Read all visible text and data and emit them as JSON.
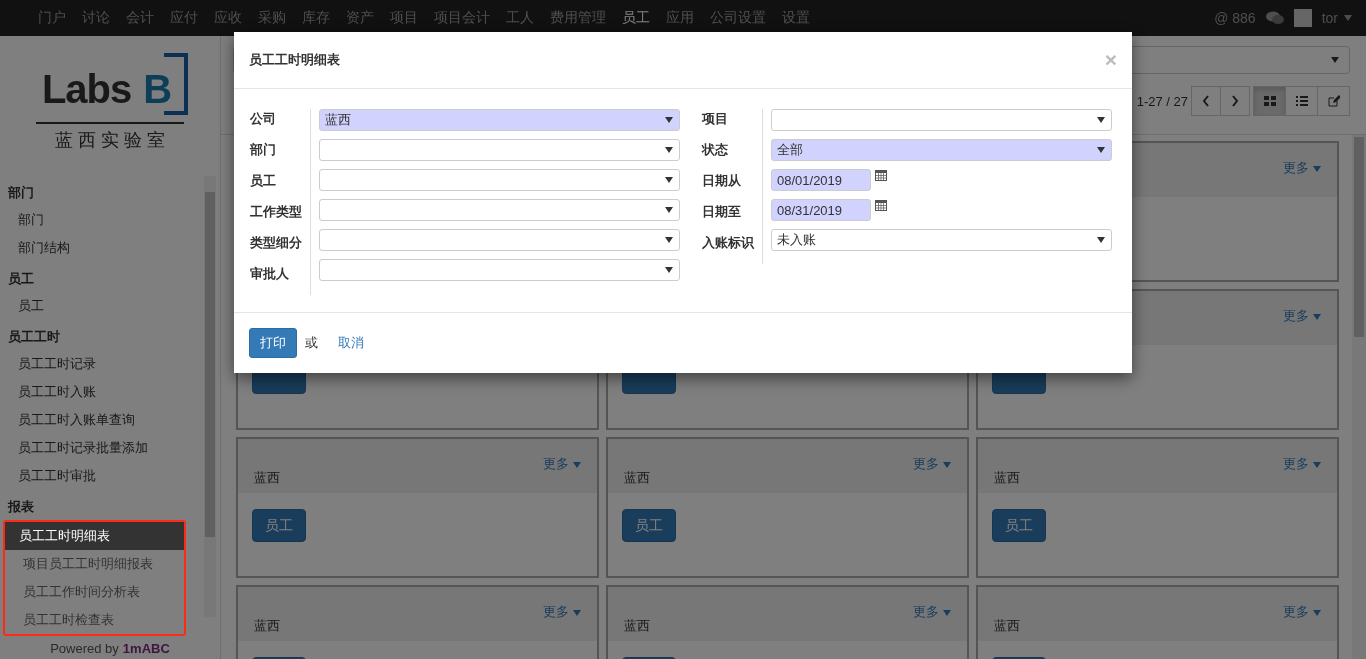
{
  "topbar": {
    "menu": [
      {
        "label": "门户",
        "selected": false
      },
      {
        "label": "讨论",
        "selected": false
      },
      {
        "label": "会计",
        "selected": false
      },
      {
        "label": "应付",
        "selected": false
      },
      {
        "label": "应收",
        "selected": false
      },
      {
        "label": "采购",
        "selected": false
      },
      {
        "label": "库存",
        "selected": false
      },
      {
        "label": "资产",
        "selected": false
      },
      {
        "label": "项目",
        "selected": false
      },
      {
        "label": "项目会计",
        "selected": false
      },
      {
        "label": "工人",
        "selected": false
      },
      {
        "label": "费用管理",
        "selected": false
      },
      {
        "label": "员工",
        "selected": true
      },
      {
        "label": "应用",
        "selected": false
      },
      {
        "label": "公司设置",
        "selected": false
      },
      {
        "label": "设置",
        "selected": false
      }
    ],
    "mentions": "@ 886",
    "user": "tor"
  },
  "logo": {
    "word": "Labs",
    "letter": "B",
    "subtitle": "蓝 西 实 验 室"
  },
  "sidebar": {
    "sections": [
      {
        "title": "部门",
        "items": [
          {
            "label": "部门",
            "selected": false
          },
          {
            "label": "部门结构",
            "selected": false
          }
        ]
      },
      {
        "title": "员工",
        "items": [
          {
            "label": "员工",
            "selected": false
          }
        ]
      },
      {
        "title": "员工工时",
        "items": [
          {
            "label": "员工工时记录",
            "selected": false
          },
          {
            "label": "员工工时入账",
            "selected": false
          },
          {
            "label": "员工工时入账单查询",
            "selected": false
          },
          {
            "label": "员工工时记录批量添加",
            "selected": false
          },
          {
            "label": "员工工时审批",
            "selected": false
          }
        ]
      },
      {
        "title": "报表",
        "highlighted": true,
        "items": [
          {
            "label": "员工工时明细表",
            "selected": true
          },
          {
            "label": "项目员工工时明细报表",
            "selected": false
          },
          {
            "label": "员工工作时间分析表",
            "selected": false
          },
          {
            "label": "员工工时检查表",
            "selected": false
          }
        ]
      }
    ],
    "footer": {
      "prefix": "Powered by",
      "brand": "1mABC"
    }
  },
  "control_panel": {
    "pager": "1-27 / 27",
    "views": [
      {
        "kind": "kanban",
        "selected": true
      },
      {
        "kind": "list",
        "selected": false
      },
      {
        "kind": "edit",
        "selected": false
      }
    ]
  },
  "cards": [
    {
      "kind": "card",
      "more": "更多"
    },
    {
      "kind": "card",
      "button": true
    },
    {
      "kind": "card",
      "button": true
    },
    {
      "kind": "card",
      "more": "更多",
      "button": true
    },
    {
      "kind": "card",
      "more": "更多",
      "company": "蓝西",
      "button": true,
      "button_label": "员工"
    },
    {
      "kind": "card",
      "more": "更多",
      "company": "蓝西",
      "button": true,
      "button_label": "员工"
    },
    {
      "kind": "card",
      "more": "更多",
      "company": "蓝西",
      "button": true,
      "button_label": "员工"
    },
    {
      "kind": "card",
      "more": "更多",
      "company": "蓝西",
      "button": true
    },
    {
      "kind": "card",
      "more": "更多",
      "company": "蓝西",
      "button": true
    },
    {
      "kind": "card",
      "more": "更多",
      "company": "蓝西",
      "button": true
    }
  ],
  "dialog": {
    "title": "员工工时明细表",
    "close": "×",
    "left_fields": [
      {
        "label": "公司",
        "value": "蓝西",
        "kind": "select",
        "required": true
      },
      {
        "label": "部门",
        "kind": "select",
        "required": false
      },
      {
        "label": "员工",
        "kind": "select",
        "required": false
      },
      {
        "label": "工作类型",
        "kind": "select",
        "required": false
      },
      {
        "label": "类型细分",
        "kind": "select",
        "required": false
      },
      {
        "label": "审批人",
        "kind": "select",
        "required": false
      }
    ],
    "right_fields": [
      {
        "label": "项目",
        "kind": "select",
        "required": false
      },
      {
        "label": "状态",
        "value": "全部",
        "kind": "select",
        "required": true
      },
      {
        "label": "日期从",
        "value": "08/01/2019",
        "kind": "date",
        "required": true
      },
      {
        "label": "日期至",
        "value": "08/31/2019",
        "kind": "date",
        "required": true
      },
      {
        "label": "入账标识",
        "value": "未入账",
        "kind": "select",
        "required": false
      }
    ],
    "print_button": "打印",
    "or": "或",
    "cancel": "取消"
  }
}
